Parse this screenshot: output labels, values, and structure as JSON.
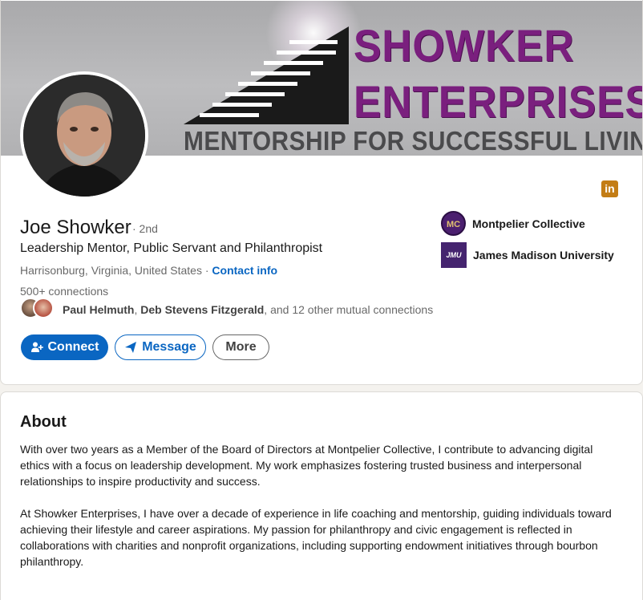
{
  "profile": {
    "banner": {
      "line1": "SHOWKER",
      "line2": "ENTERPRISES",
      "tagline": "MENTORSHIP FOR SUCCESSFUL LIVING"
    },
    "name": "Joe Showker",
    "degree": "· 2nd",
    "headline": "Leadership Mentor, Public Servant and Philanthropist",
    "location": "Harrisonburg, Virginia, United States ·",
    "contact_info": "Contact info",
    "connections": "500+ connections",
    "mutual": {
      "name1": "Paul Helmuth",
      "name2": "Deb Stevens Fitzgerald",
      "rest": ", and 12 other mutual connections",
      "separator": ", "
    },
    "buttons": {
      "connect": "Connect",
      "message": "Message",
      "more": "More"
    },
    "orgs": [
      {
        "name": "Montpelier Collective",
        "logo_text": "MC"
      },
      {
        "name": "James Madison University",
        "logo_text": "JMU"
      }
    ],
    "linkedin_icon_text": "in"
  },
  "about": {
    "title": "About",
    "paragraphs": [
      "With over two years as a Member of the Board of Directors at Montpelier Collective, I contribute to advancing digital ethics with a focus on leadership development. My work emphasizes fostering trusted business and interpersonal relationships to inspire productivity and success.",
      "At Showker Enterprises, I have over a decade of experience in life coaching and mentorship, guiding individuals toward achieving their lifestyle and career aspirations. My passion for philanthropy and civic engagement is reflected in collaborations with charities and nonprofit organizations, including supporting endowment initiatives through bourbon philanthropy."
    ]
  },
  "colors": {
    "primary": "#0a66c2",
    "banner_purple": "#7a1f7e",
    "linkedin_badge": "#c37d16"
  }
}
